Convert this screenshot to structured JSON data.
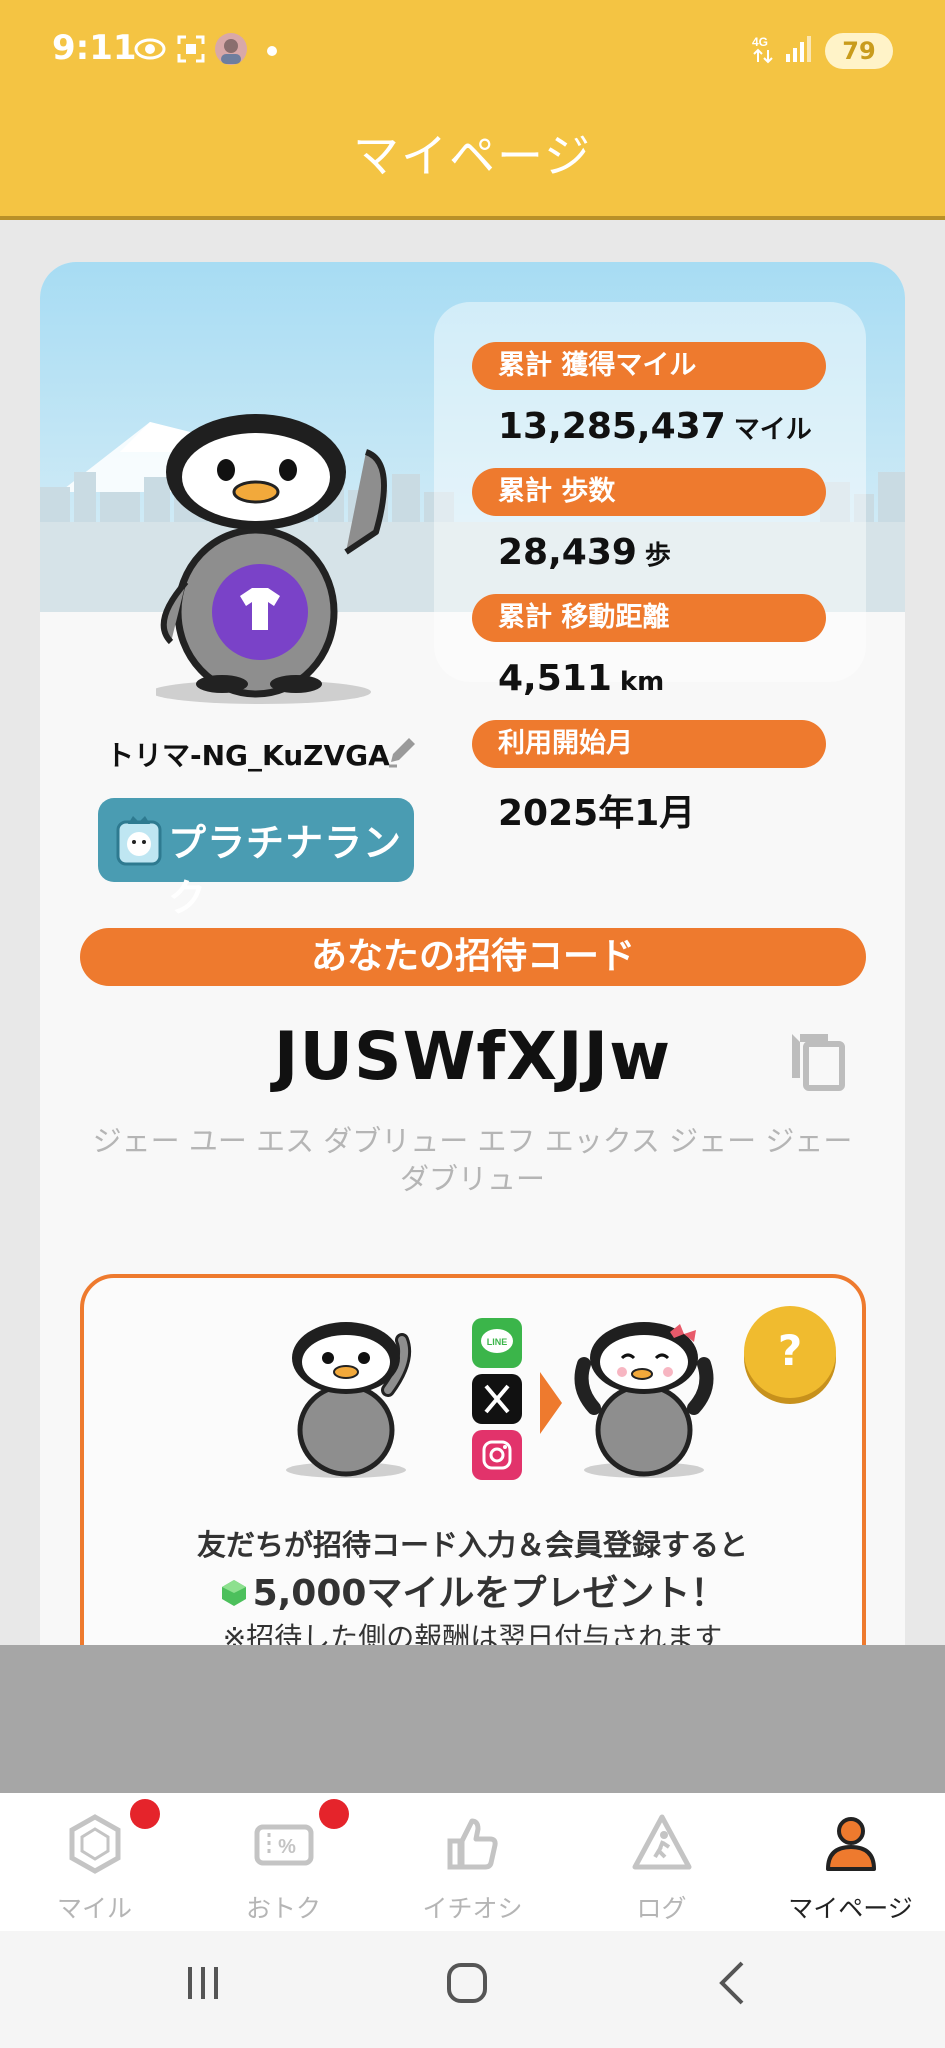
{
  "status_bar": {
    "time": "9:11",
    "network": "4G",
    "battery": "79",
    "icons": [
      "eye-icon",
      "screenshot-icon",
      "avatar-icon",
      "dot-icon",
      "signal-icon",
      "battery-icon"
    ]
  },
  "header": {
    "title": "マイページ"
  },
  "profile": {
    "username": "トリマ-NG_KuZVGA",
    "rank": "プラチナランク"
  },
  "stats": [
    {
      "label": "累計 獲得マイル",
      "value": "13,285,437",
      "unit": "マイル"
    },
    {
      "label": "累計 歩数",
      "value": "28,439",
      "unit": "歩"
    },
    {
      "label": "累計 移動距離",
      "value": "4,511",
      "unit": "km"
    },
    {
      "label": "利用開始月",
      "value": "2025年1月",
      "unit": ""
    }
  ],
  "invite": {
    "title": "あなたの招待コード",
    "code": "JUSWfXJJw",
    "reading": "ジェー ユー エス ダブリュー エフ エックス ジェー ジェー ダブリュー"
  },
  "referral": {
    "help": "?",
    "line1": "友だちが招待コード入力＆会員登録すると",
    "line2": "5,000マイルをプレゼント！",
    "line3": "※招待した側の報酬は翌日付与されます",
    "sns": [
      "LINE",
      "X",
      "Instagram"
    ]
  },
  "bottom_nav": [
    {
      "label": "マイル",
      "icon": "gem-icon",
      "badge": true,
      "active": false
    },
    {
      "label": "おトク",
      "icon": "coupon-icon",
      "badge": true,
      "active": false
    },
    {
      "label": "イチオシ",
      "icon": "thumbs-up-icon",
      "badge": false,
      "active": false
    },
    {
      "label": "ログ",
      "icon": "walking-log-icon",
      "badge": false,
      "active": false
    },
    {
      "label": "マイページ",
      "icon": "person-icon",
      "badge": false,
      "active": true
    }
  ],
  "colors": {
    "header": "#f4c443",
    "accent_orange": "#ee7a2e",
    "rank_badge": "#4a9cb2",
    "nav_active": "#ee7a2e",
    "badge_red": "#e5242b"
  }
}
